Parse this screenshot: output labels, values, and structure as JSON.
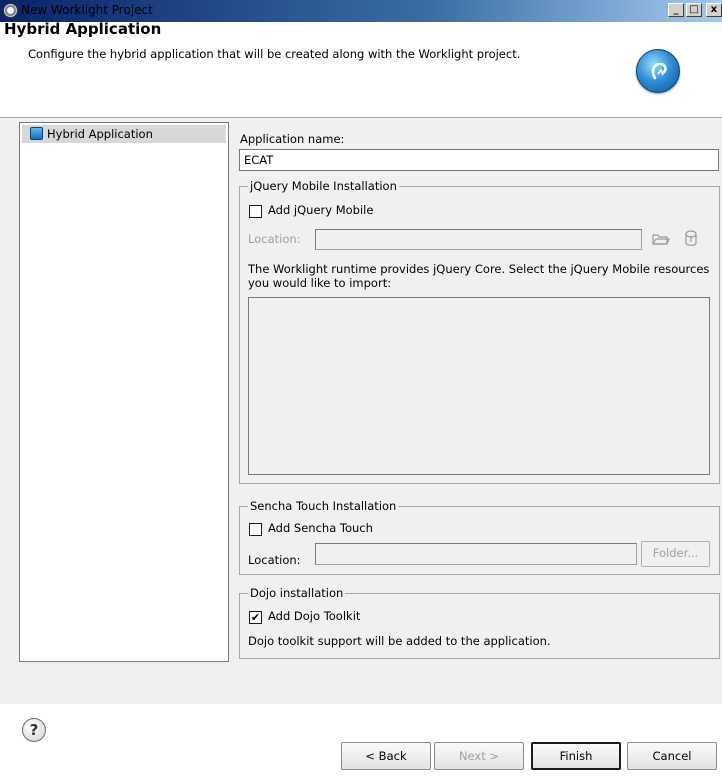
{
  "window": {
    "title": "New Worklight Project",
    "minimize_glyph": "_",
    "maximize_glyph": "□",
    "close_glyph": "x"
  },
  "header": {
    "title": "Hybrid Application",
    "description": "Configure the hybrid application that will be created along with the Worklight project."
  },
  "tree": {
    "items": [
      {
        "label": "Hybrid Application",
        "selected": true
      }
    ]
  },
  "form": {
    "app_name_label": "Application name:",
    "app_name_value": "ECAT",
    "jquery": {
      "group_title": "jQuery Mobile Installation",
      "checkbox_label": "Add jQuery Mobile",
      "checked": false,
      "location_label": "Location:",
      "location_value": "",
      "description": "The Worklight runtime provides jQuery Core. Select the jQuery Mobile resources you would like to import:"
    },
    "sencha": {
      "group_title": "Sencha Touch Installation",
      "checkbox_label": "Add Sencha Touch",
      "checked": false,
      "location_label": "Location:",
      "location_value": "",
      "folder_button": "Folder..."
    },
    "dojo": {
      "group_title": "Dojo installation",
      "checkbox_label": "Add Dojo Toolkit",
      "checked": true,
      "description": "Dojo toolkit support will be added to the application."
    }
  },
  "buttons": {
    "help": "?",
    "back": "< Back",
    "next": "Next >",
    "finish": "Finish",
    "cancel": "Cancel"
  },
  "check_glyph": "✔"
}
